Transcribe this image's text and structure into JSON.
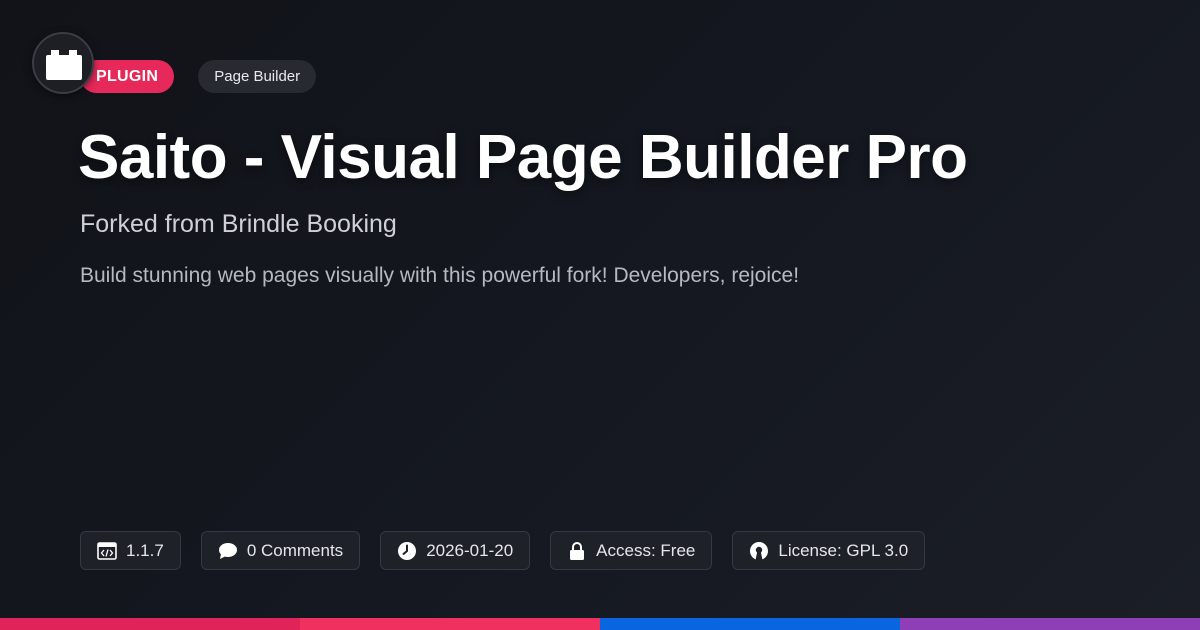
{
  "hero": {
    "type_badge": "PLUGIN",
    "category_badge": "Page Builder",
    "title": "Saito - Visual Page Builder Pro",
    "subtitle": "Forked from Brindle Booking",
    "description": "Build stunning web pages visually with this powerful fork! Developers, rejoice!"
  },
  "meta": {
    "version": "1.1.7",
    "comments": "0 Comments",
    "date": "2026-01-20",
    "access": "Access: Free",
    "license": "License: GPL 3.0"
  },
  "icons": {
    "logo": "plugin-block-icon",
    "version": "code-window-icon",
    "comments": "speech-bubble-icon",
    "date": "clock-icon",
    "access": "lock-icon",
    "license": "open-source-icon"
  },
  "colors": {
    "background": "#13151b",
    "accent": "#e6295a",
    "stripe": [
      "#e0245a",
      "#f0305e",
      "#0a66e0",
      "#8e3fb5"
    ]
  }
}
